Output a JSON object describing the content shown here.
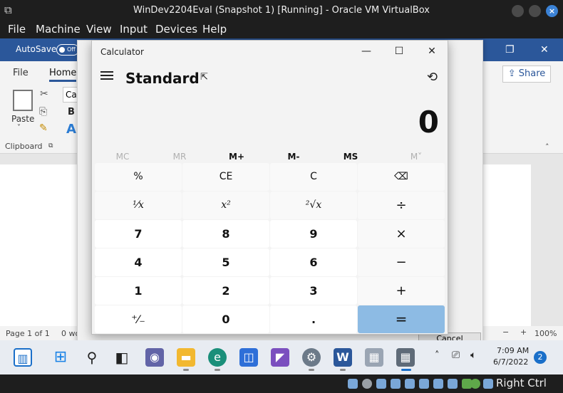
{
  "vbox": {
    "title": "WinDev2204Eval (Snapshot 1) [Running] - Oracle VM VirtualBox",
    "menu": [
      "File",
      "Machine",
      "View",
      "Input",
      "Devices",
      "Help"
    ],
    "host_key": "Right Ctrl"
  },
  "word": {
    "autosave_label": "AutoSave",
    "autosave_state": "Off",
    "tabs": [
      "File",
      "Home"
    ],
    "share_label": "Share",
    "font_box": "Cal",
    "paste_label": "Paste",
    "clipboard_label": "Clipboard",
    "status_page": "Page 1 of 1",
    "status_words": "0 wo",
    "zoom": "100%",
    "dialog_cancel": "Cancel"
  },
  "calculator": {
    "window_title": "Calculator",
    "mode": "Standard",
    "display": "0",
    "memory": [
      "MC",
      "MR",
      "M+",
      "M-",
      "MS",
      "M˅"
    ],
    "keys": [
      [
        "%",
        "CE",
        "C",
        "⌫"
      ],
      [
        "¹⁄x",
        "x²",
        "²√x",
        "÷"
      ],
      [
        "7",
        "8",
        "9",
        "×"
      ],
      [
        "4",
        "5",
        "6",
        "−"
      ],
      [
        "1",
        "2",
        "3",
        "+"
      ],
      [
        "⁺⁄₋",
        "0",
        ".",
        "="
      ]
    ]
  },
  "taskbar": {
    "time": "7:09 AM",
    "date": "6/7/2022",
    "notification_count": "2"
  },
  "colors": {
    "word_blue": "#2b579a",
    "equals_key": "#8dbbe4",
    "taskbar_bg": "#e8ecf2"
  }
}
